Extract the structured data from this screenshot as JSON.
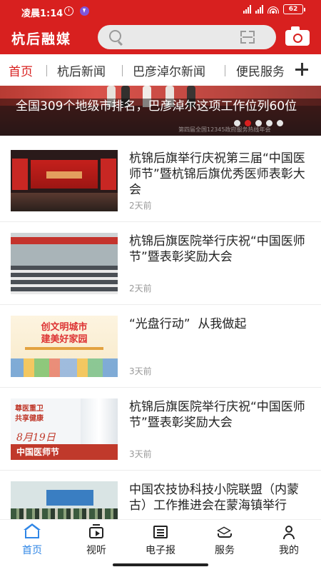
{
  "status_bar": {
    "time": "凌晨1:14",
    "battery": "62"
  },
  "header": {
    "logo": "杭后融媒",
    "search_placeholder": ""
  },
  "tabs": [
    {
      "label": "首页",
      "active": true
    },
    {
      "label": "杭后新闻",
      "active": false
    },
    {
      "label": "巴彦淖尔新闻",
      "active": false
    },
    {
      "label": "便民服务",
      "active": false
    }
  ],
  "banner": {
    "title": "全国309个地级市排名，巴彦淖尔这项工作位列60位",
    "caption": "第四届全国12345政府服务热线年会",
    "dots": 5,
    "active_dot": 1
  },
  "news": [
    {
      "title": "杭锦后旗举行庆祝第三届“中国医师节”暨杭锦后旗优秀医师表彰大会",
      "time": "2天前",
      "thumb": "stage"
    },
    {
      "title": "杭锦后旗医院举行庆祝“中国医师节”暨表彰奖励大会",
      "time": "2天前",
      "thumb": "hall"
    },
    {
      "title": "“光盘行动”  从我做起",
      "time": "3天前",
      "thumb": "poster",
      "thumb_text": "创文明城市\n建美好家园"
    },
    {
      "title": "杭锦后旗医院举行庆祝“中国医师节”暨表彰奖励大会",
      "time": "3天前",
      "thumb": "doctors-day",
      "thumb_text_1": "尊医重卫\n共享健康",
      "thumb_date": "8月19日",
      "thumb_band": "中国医师节"
    },
    {
      "title": "中国农技协科技小院联盟（内蒙古）工作推进会在蒙海镇举行",
      "time": "",
      "thumb": "meeting"
    }
  ],
  "bottom_nav": [
    {
      "label": "首页",
      "icon": "home-icon",
      "active": true
    },
    {
      "label": "视听",
      "icon": "tv-icon",
      "active": false
    },
    {
      "label": "电子报",
      "icon": "newspaper-icon",
      "active": false
    },
    {
      "label": "服务",
      "icon": "layers-icon",
      "active": false
    },
    {
      "label": "我的",
      "icon": "user-icon",
      "active": false
    }
  ],
  "colors": {
    "brand_red": "#d8201f",
    "active_nav_blue": "#2f86e6"
  }
}
